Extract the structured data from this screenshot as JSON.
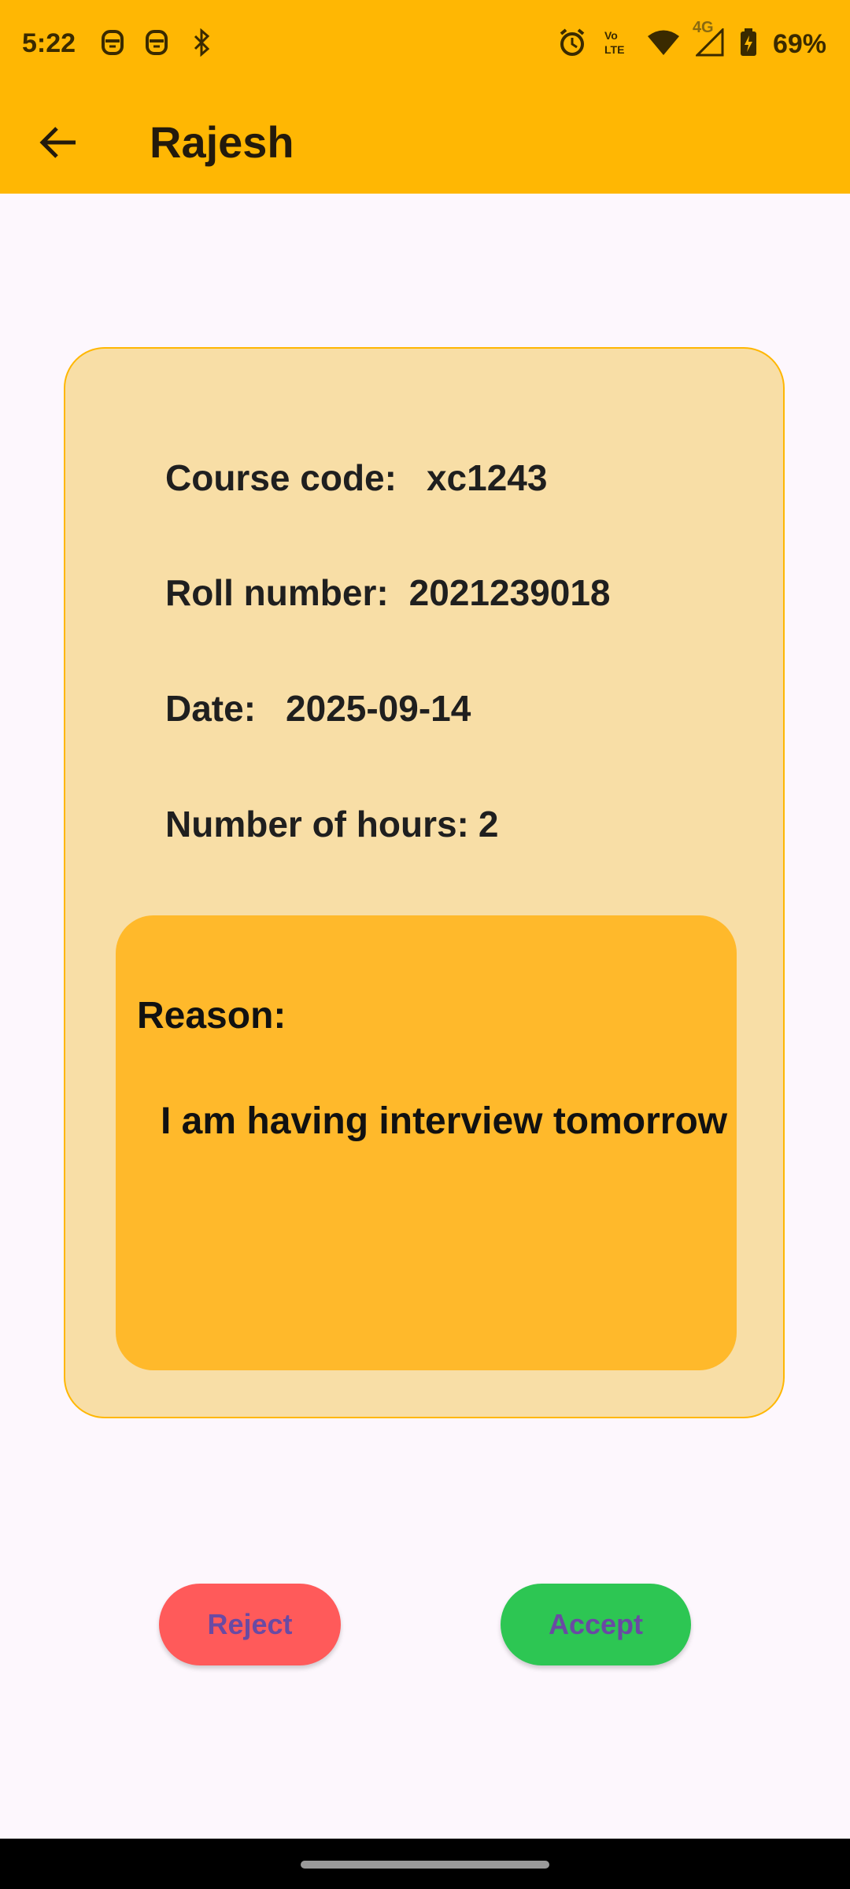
{
  "status_bar": {
    "time": "5:22",
    "battery": "69%",
    "network": "4G",
    "icons": [
      "robot-icon",
      "robot-icon",
      "bluetooth-icon",
      "alarm-icon",
      "volte-icon",
      "wifi-icon",
      "signal-icon",
      "battery-icon"
    ]
  },
  "app_bar": {
    "title": "Rajesh",
    "back_icon": "arrow-left-icon",
    "background": "#ffb703"
  },
  "card": {
    "fields": [
      {
        "label": "Course code:",
        "value": "xc1243"
      },
      {
        "label": "Roll number:",
        "value": "2021239018"
      },
      {
        "label": "Date:",
        "value": "2025-09-14"
      },
      {
        "label": "Number of hours:",
        "value": "2"
      }
    ],
    "reason": {
      "label": "Reason:",
      "text": "I am having interview tomorrow"
    },
    "background": "#f8dea6",
    "reason_background": "#ffb92b"
  },
  "actions": {
    "reject_label": "Reject",
    "accept_label": "Accept",
    "reject_color": "#ff5a5a",
    "accept_color": "#2dc653"
  }
}
